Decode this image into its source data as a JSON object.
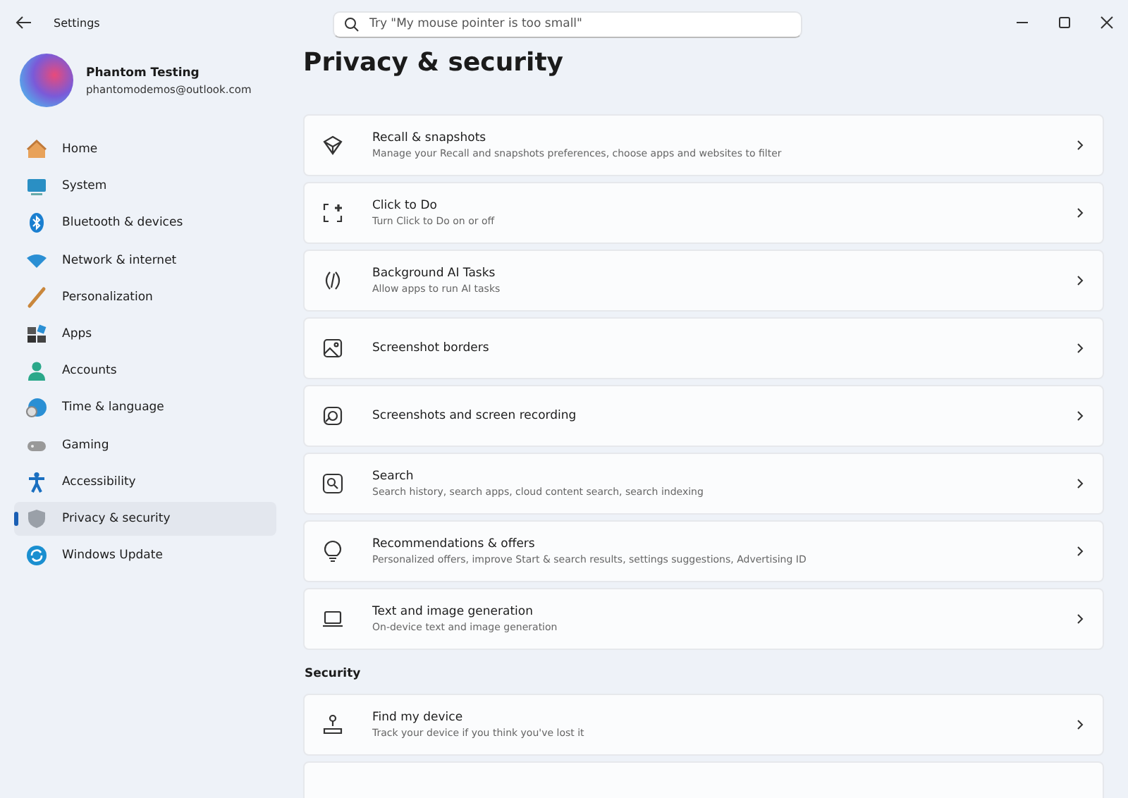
{
  "window": {
    "title": "Settings"
  },
  "search": {
    "placeholder": "Try \"My mouse pointer is too small\""
  },
  "account": {
    "name": "Phantom Testing",
    "email": "phantomodemos@outlook.com"
  },
  "sidebar": {
    "items": [
      {
        "label": "Home",
        "selected": false
      },
      {
        "label": "System",
        "selected": false
      },
      {
        "label": "Bluetooth & devices",
        "selected": false
      },
      {
        "label": "Network & internet",
        "selected": false
      },
      {
        "label": "Personalization",
        "selected": false
      },
      {
        "label": "Apps",
        "selected": false
      },
      {
        "label": "Accounts",
        "selected": false
      },
      {
        "label": "Time & language",
        "selected": false
      },
      {
        "label": "Gaming",
        "selected": false
      },
      {
        "label": "Accessibility",
        "selected": false
      },
      {
        "label": "Privacy & security",
        "selected": true
      },
      {
        "label": "Windows Update",
        "selected": false
      }
    ]
  },
  "page_title": "Privacy & security",
  "sections": [
    {
      "items": [
        {
          "title": "Recall & snapshots",
          "subtitle": "Manage your Recall and snapshots preferences, choose apps and websites to filter"
        },
        {
          "title": "Click to Do",
          "subtitle": "Turn Click to Do on or off"
        },
        {
          "title": "Background AI Tasks",
          "subtitle": "Allow apps to run AI tasks"
        },
        {
          "title": "Screenshot borders"
        },
        {
          "title": "Screenshots and screen recording"
        },
        {
          "title": "Search",
          "subtitle": "Search history, search apps, cloud content search, search indexing"
        },
        {
          "title": "Recommendations & offers",
          "subtitle": "Personalized offers, improve Start & search results, settings suggestions, Advertising ID"
        },
        {
          "title": "Text and image generation",
          "subtitle": "On-device text and image generation"
        }
      ]
    },
    {
      "heading": "Security",
      "items": [
        {
          "title": "Find my device",
          "subtitle": "Track your device if you think you've lost it"
        }
      ]
    }
  ]
}
